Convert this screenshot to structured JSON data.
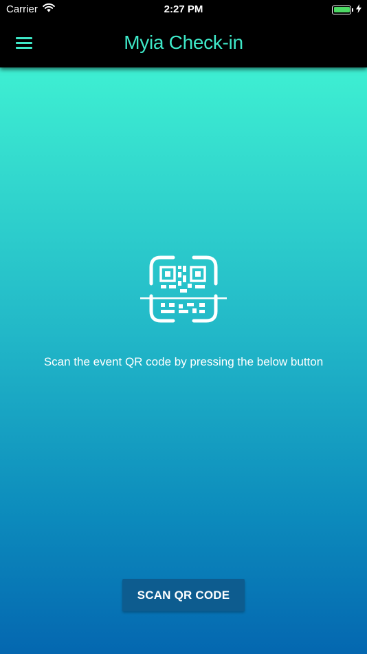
{
  "status_bar": {
    "carrier": "Carrier",
    "time": "2:27 PM",
    "battery_level": 1.0,
    "icons": [
      "wifi-icon",
      "battery-icon",
      "charging-bolt-icon"
    ]
  },
  "nav": {
    "title": "Myia Check-in",
    "menu_icon": "hamburger-menu-icon"
  },
  "main": {
    "icon": "qr-code-scan-icon",
    "instruction": "Scan the event QR code by pressing the below button",
    "scan_button_label": "SCAN QR CODE"
  },
  "colors": {
    "accent": "#3ee8c8",
    "nav_background": "#000000",
    "gradient_top": "#3eefd2",
    "gradient_bottom": "#0467b0",
    "button_background": "#0d5c8f",
    "battery_green": "#4cd964"
  }
}
